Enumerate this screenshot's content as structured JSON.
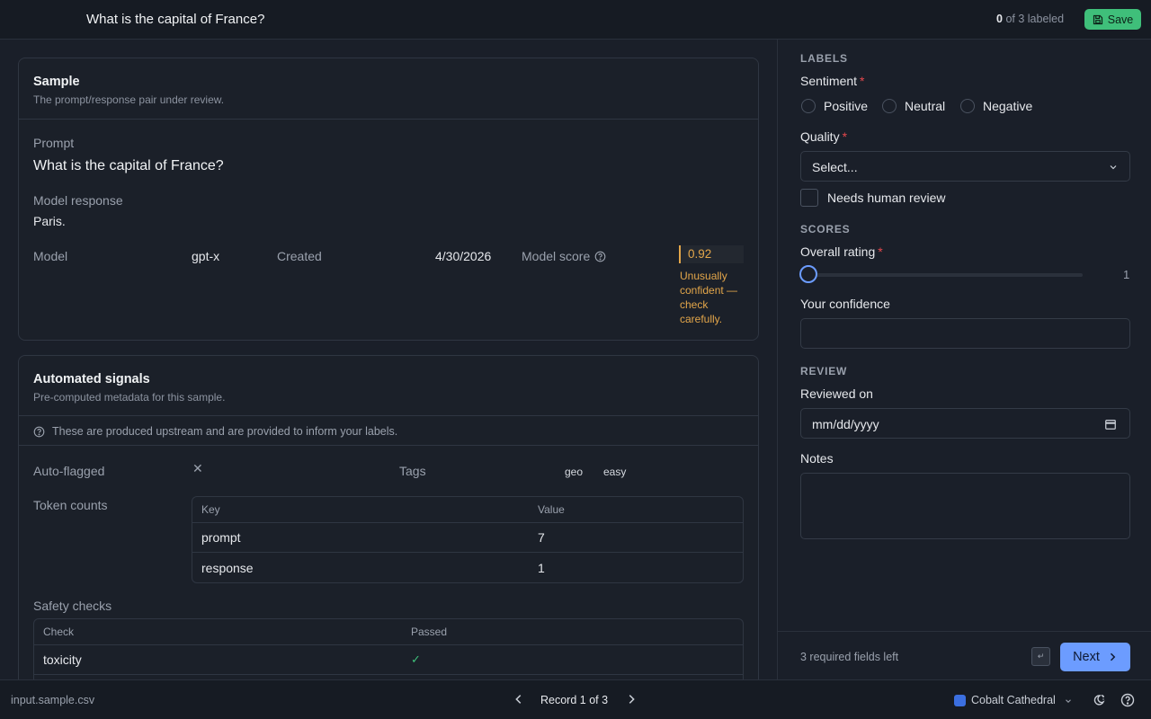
{
  "header": {
    "title": "What is the capital of France?",
    "progress_count": "0",
    "progress_text": "of 3 labeled",
    "save_label": "Save"
  },
  "sample": {
    "title": "Sample",
    "subtitle": "The prompt/response pair under review.",
    "prompt_label": "Prompt",
    "prompt_value": "What is the capital of France?",
    "response_label": "Model response",
    "response_value": "Paris.",
    "model_label": "Model",
    "model_value": "gpt-x",
    "created_label": "Created",
    "created_value": "4/30/2026",
    "score_label": "Model score",
    "score_value": "0.92",
    "score_warning": "Unusually confident — check carefully."
  },
  "signals": {
    "title": "Automated signals",
    "subtitle": "Pre-computed metadata for this sample.",
    "info": "These are produced upstream and are provided to inform your labels.",
    "auto_flagged_label": "Auto-flagged",
    "auto_flagged_value": "✕",
    "tags_label": "Tags",
    "tags": [
      "geo",
      "easy"
    ],
    "token_counts_label": "Token counts",
    "token_table": {
      "headers": [
        "Key",
        "Value"
      ],
      "rows": [
        [
          "prompt",
          "7"
        ],
        [
          "response",
          "1"
        ]
      ]
    },
    "safety_label": "Safety checks",
    "safety_table": {
      "headers": [
        "Check",
        "Passed"
      ],
      "rows": [
        [
          "toxicity",
          "✓"
        ]
      ]
    }
  },
  "form": {
    "labels_section": "LABELS",
    "sentiment_label": "Sentiment",
    "sentiment_options": [
      "Positive",
      "Neutral",
      "Negative"
    ],
    "quality_label": "Quality",
    "quality_value": "Select...",
    "needs_review_label": "Needs human review",
    "scores_section": "SCORES",
    "overall_label": "Overall rating",
    "overall_value": "1",
    "confidence_label": "Your confidence",
    "confidence_value": "",
    "review_section": "REVIEW",
    "reviewed_on_label": "Reviewed on",
    "reviewed_on_placeholder": "mm/dd/yyyy",
    "notes_label": "Notes",
    "notes_value": "",
    "required_left": "3 required fields left",
    "enter_key": "↵",
    "next_label": "Next"
  },
  "footer": {
    "file": "input.sample.csv",
    "record": "Record 1 of 3",
    "theme": "Cobalt Cathedral",
    "theme_color": "#3b6fe0"
  },
  "colors": {
    "accent": "#6c9cff",
    "save": "#3fbf7a",
    "warning": "#e3a64a",
    "required": "#e5484d",
    "pass": "#3fbf7a"
  }
}
